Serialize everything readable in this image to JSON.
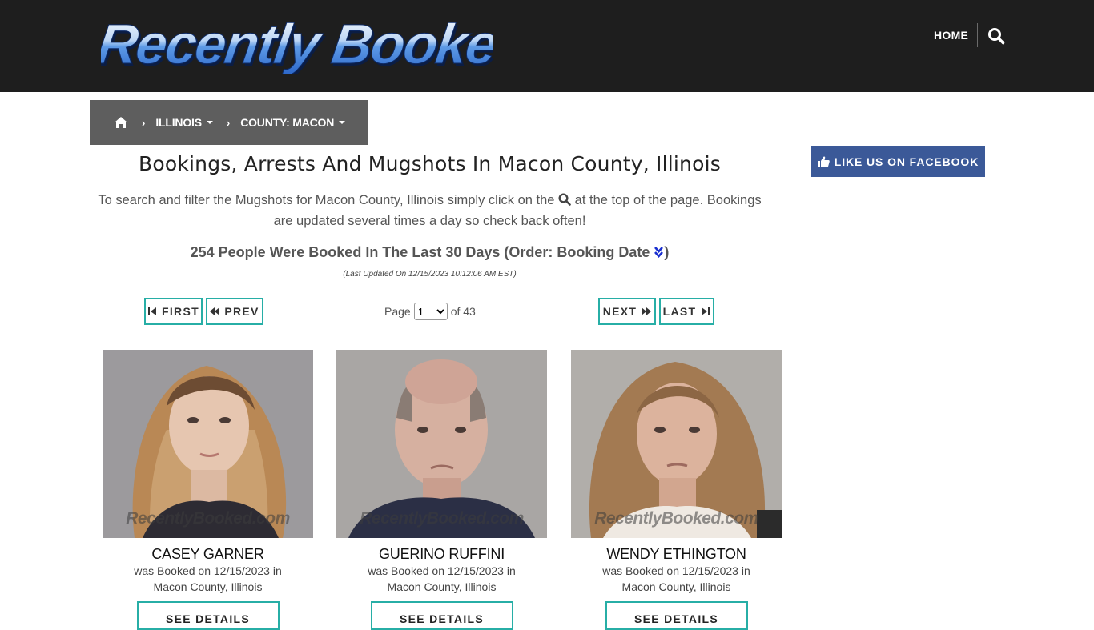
{
  "header": {
    "logo_text": "Recently Booked",
    "nav_home": "HOME",
    "search_icon": "search-icon"
  },
  "breadcrumb": {
    "home_icon": "home-icon",
    "items": [
      {
        "label": "ILLINOIS"
      },
      {
        "label": "COUNTY: MACON"
      }
    ]
  },
  "main": {
    "title": "Bookings, Arrests And Mugshots In Macon County, Illinois",
    "intro_before": "To search and filter the Mugshots for Macon County, Illinois simply click on the",
    "intro_after": "at the top of the page. Bookings are updated several times a day so check back often!",
    "count_text": "254 People Were Booked In The Last 30 Days (Order: Booking Date",
    "count_close": ")",
    "updated": "(Last Updated On 12/15/2023 10:12:06 AM EST)"
  },
  "pagination": {
    "first": "FIRST",
    "prev": "PREV",
    "next": "NEXT",
    "last": "LAST",
    "page_label": "Page",
    "page_value": "1",
    "of_label": "of 43"
  },
  "cards": [
    {
      "name": "CASEY GARNER",
      "desc_line1": "was Booked on 12/15/2023 in",
      "desc_line2": "Macon County, Illinois",
      "button": "SEE DETAILS",
      "watermark": "RecentlyBooked.com"
    },
    {
      "name": "GUERINO RUFFINI",
      "desc_line1": "was Booked on 12/15/2023 in",
      "desc_line2": "Macon County, Illinois",
      "button": "SEE DETAILS",
      "watermark": "RecentlyBooked.com"
    },
    {
      "name": "WENDY ETHINGTON",
      "desc_line1": "was Booked on 12/15/2023 in",
      "desc_line2": "Macon County, Illinois",
      "button": "SEE DETAILS",
      "watermark": "RecentlyBooked.com"
    }
  ],
  "sidebar": {
    "facebook_label": "LIKE US ON FACEBOOK"
  },
  "colors": {
    "header_bg": "#1e1e1e",
    "breadcrumb_bg": "#5e5e5e",
    "button_border": "#27aea6",
    "facebook_bg": "#3b5998",
    "order_icon": "#1a2fd0"
  }
}
